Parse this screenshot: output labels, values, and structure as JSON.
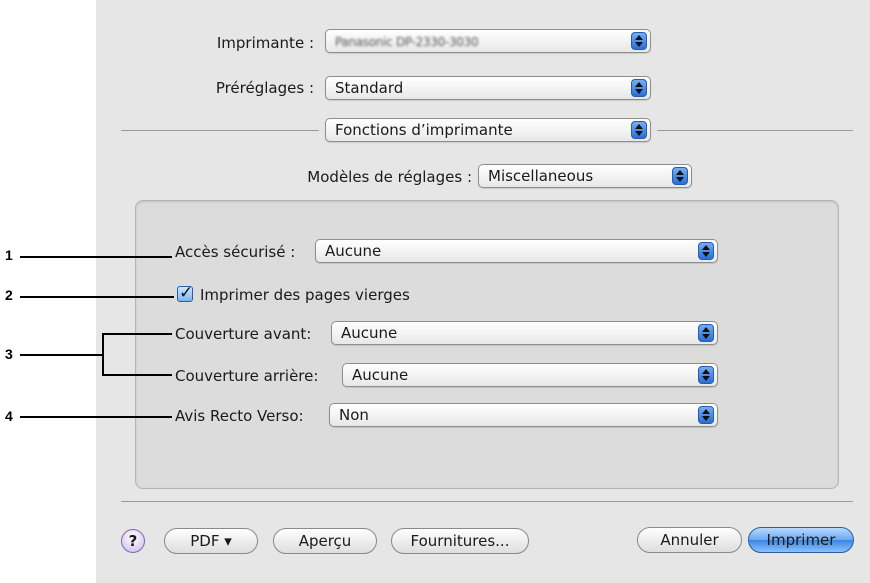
{
  "printer": {
    "label": "Imprimante :",
    "value": "Panasonic DP-2330-3030"
  },
  "presets": {
    "label": "Préréglages :",
    "value": "Standard"
  },
  "section_popup": {
    "value": "Fonctions d’imprimante"
  },
  "models": {
    "label": "Modèles de réglages :",
    "value": "Miscellaneous"
  },
  "settings": {
    "secure_access": {
      "label": "Accès sécurisé :",
      "value": "Aucune"
    },
    "print_blank": {
      "label": "Imprimer des pages vierges",
      "checked": true
    },
    "front_cover": {
      "label": "Couverture avant:",
      "value": "Aucune"
    },
    "back_cover": {
      "label": "Couverture arrière:",
      "value": "Aucune"
    },
    "duplex_notice": {
      "label": "Avis Recto Verso:",
      "value": "Non"
    }
  },
  "callouts": [
    "1",
    "2",
    "3",
    "4"
  ],
  "buttons": {
    "help": "?",
    "pdf": "PDF ▾",
    "preview": "Aperçu",
    "supplies": "Fournitures...",
    "cancel": "Annuler",
    "print": "Imprimer"
  },
  "colors": {
    "accent": "#3d85e4",
    "background": "#e6e6e6"
  }
}
